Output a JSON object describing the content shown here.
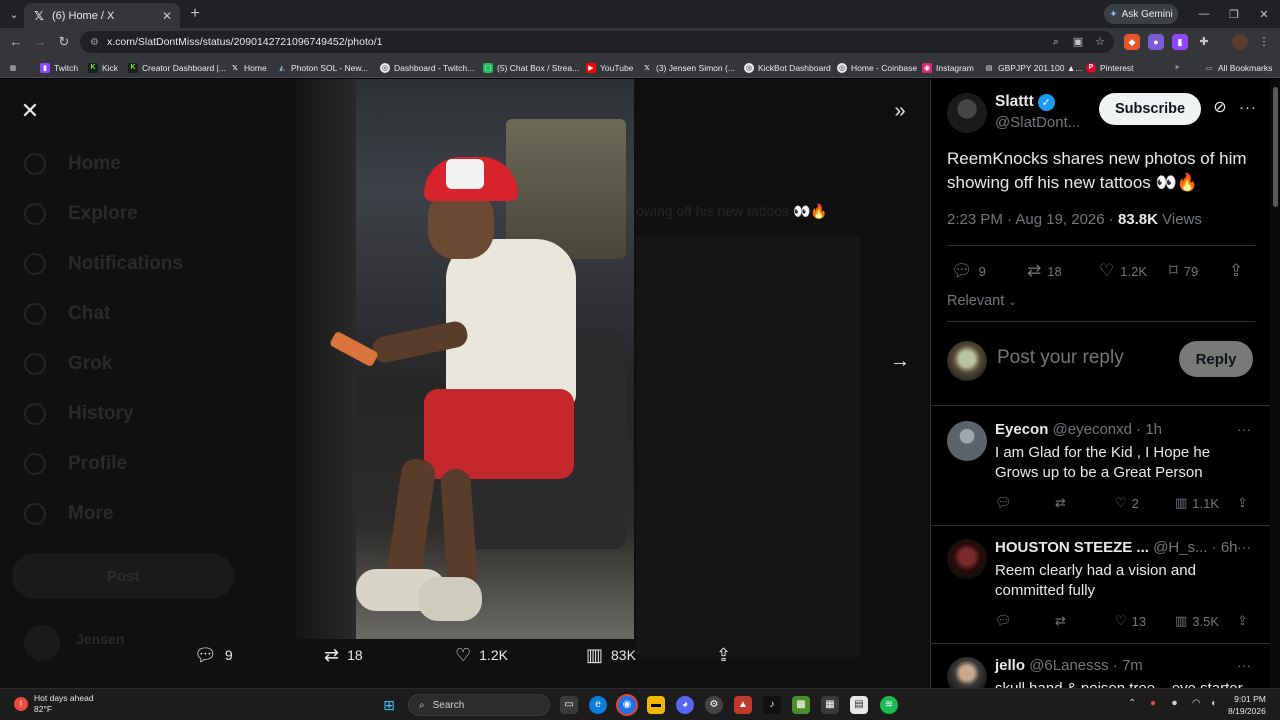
{
  "browser": {
    "tab_title": "(6) Home / X",
    "url": "x.com/SlatDontMiss/status/2090142721096749452/photo/1",
    "gemini_label": "Ask Gemini",
    "bookmarks": [
      "Twitch",
      "Kick",
      "Creator Dashboard |...",
      "Home",
      "Photon SOL - New...",
      "Dashboard - Twitch...",
      "(5) Chat Box / Strea...",
      "YouTube",
      "(3) Jensen Simon (...",
      "KickBot Dashboard",
      "Home - Coinbase",
      "Instagram",
      "GBPJPY 201.100 ▲...",
      "Pinterest"
    ],
    "all_bookmarks": "All Bookmarks"
  },
  "sidebar_ghost": {
    "items": [
      "Home",
      "Explore",
      "Notifications",
      "Chat",
      "Grok",
      "History",
      "Profile",
      "More"
    ],
    "post": "Post",
    "user_name": "Jensen"
  },
  "ghost_text": "owing off his new tattoos 👀🔥",
  "media_bar": {
    "replies": "9",
    "reposts": "18",
    "likes": "1.2K",
    "views": "83K"
  },
  "tweet": {
    "author_name": "Slattt",
    "author_handle": "@SlatDont...",
    "subscribe_label": "Subscribe",
    "text": "ReemKnocks shares new photos of him showing off his new tattoos 👀🔥",
    "time": "2:23 PM · Aug 19, 2026 · ",
    "views_count": "83.8K",
    "views_label": " Views",
    "stats": {
      "replies": "9",
      "reposts": "18",
      "likes": "1.2K",
      "bookmarks": "79"
    },
    "sort_label": "Relevant",
    "reply_placeholder": "Post your reply",
    "reply_button": "Reply"
  },
  "replies": [
    {
      "name": "Eyecon",
      "handle": "@eyeconxd · 1h",
      "text": "I am Glad for the Kid , I Hope he Grows up to be a Great Person",
      "likes": "2",
      "views": "1.1K"
    },
    {
      "name": "HOUSTON STEEZE ...",
      "handle": "@H_s... · 6h",
      "text": "Reem clearly had a vision and committed fully",
      "likes": "13",
      "views": "3.5K"
    },
    {
      "name": "jello",
      "handle": "@6Lanesss · 7m",
      "text": "skull hand & poison tree... eye starter",
      "likes": "",
      "views": ""
    }
  ],
  "taskbar": {
    "weather_title": "Hot days ahead",
    "weather_temp": "82°F",
    "search": "Search",
    "time": "9:01 PM",
    "date": "8/19/2026"
  },
  "colors": {
    "accent": "#1d9bf0",
    "muted": "#71767b",
    "text": "#e7e9ea",
    "border": "#2f3336"
  }
}
